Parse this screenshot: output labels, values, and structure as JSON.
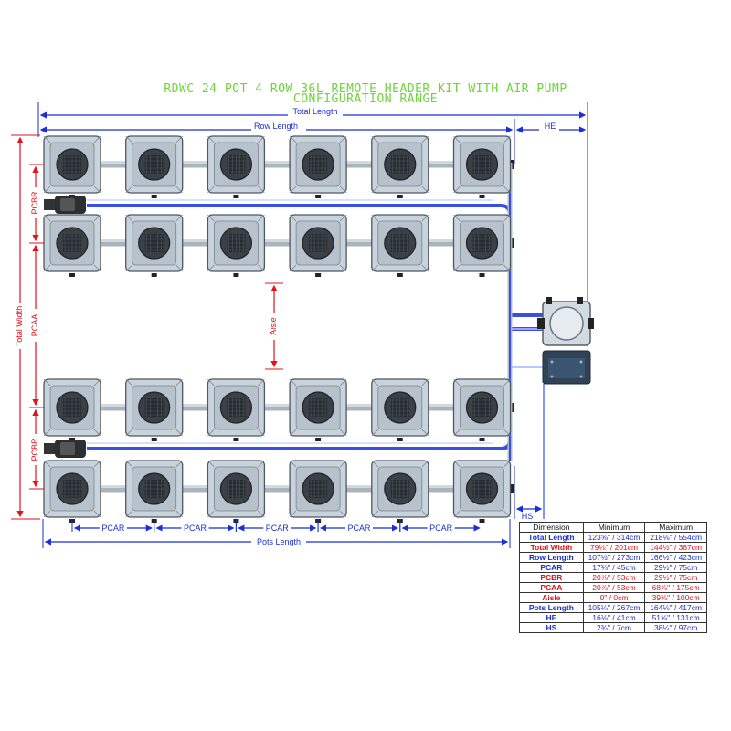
{
  "title": {
    "line1": "RDWC 24 POT 4 ROW 36L REMOTE HEADER KIT WITH AIR PUMP",
    "line2": "CONFIGURATION RANGE"
  },
  "labels": {
    "total_length": "Total Length",
    "row_length": "Row Length",
    "he": "HE",
    "hs": "HS",
    "total_width": "Total Width",
    "pcbr": "PCBR",
    "pcaa": "PCAA",
    "aisle": "Aisle",
    "pcar": "PCAR",
    "pots_length": "Pots Length"
  },
  "layout": {
    "rows": 4,
    "pots_per_row": 6,
    "pot_count": 24
  },
  "colors": {
    "title": "#6fd43b",
    "dimension_line": "#1a2fd6",
    "dimension_line_red": "#e3121b",
    "pipe_blue": "#3a4fe0",
    "pot_body": "#c9d3dc",
    "pot_lid": "#2e3338",
    "blue_text": "#1a2fd6",
    "red_text": "#e3121b"
  },
  "table": {
    "headers": [
      "Dimension",
      "Minimum",
      "Maximum"
    ],
    "rows": [
      {
        "dimension": "Total Length",
        "min": "123⅝\" / 314cm",
        "max": "218⅛\" / 554cm",
        "color": "blue"
      },
      {
        "dimension": "Total Width",
        "min": "79⅛\" / 201cm",
        "max": "144½\" / 367cm",
        "color": "red"
      },
      {
        "dimension": "Row Length",
        "min": "107½\" / 273cm",
        "max": "166½\" / 423cm",
        "color": "blue"
      },
      {
        "dimension": "PCAR",
        "min": "17¾\" / 45cm",
        "max": "29½\" / 75cm",
        "color": "blue"
      },
      {
        "dimension": "PCBR",
        "min": "20⅞\" / 53cm",
        "max": "29½\" / 75cm",
        "color": "red"
      },
      {
        "dimension": "PCAA",
        "min": "20⅞\" / 53cm",
        "max": "68⅞\" / 175cm",
        "color": "red"
      },
      {
        "dimension": "Aisle",
        "min": "0\" / 0cm",
        "max": "39⅜\" / 100cm",
        "color": "red"
      },
      {
        "dimension": "Pots Length",
        "min": "105¼\" / 267cm",
        "max": "164⅛\" / 417cm",
        "color": "blue"
      },
      {
        "dimension": "HE",
        "min": "16⅛\" / 41cm",
        "max": "51⅝\" / 131cm",
        "color": "blue"
      },
      {
        "dimension": "HS",
        "min": "2¾\" / 7cm",
        "max": "38¼\" / 97cm",
        "color": "blue"
      }
    ]
  }
}
